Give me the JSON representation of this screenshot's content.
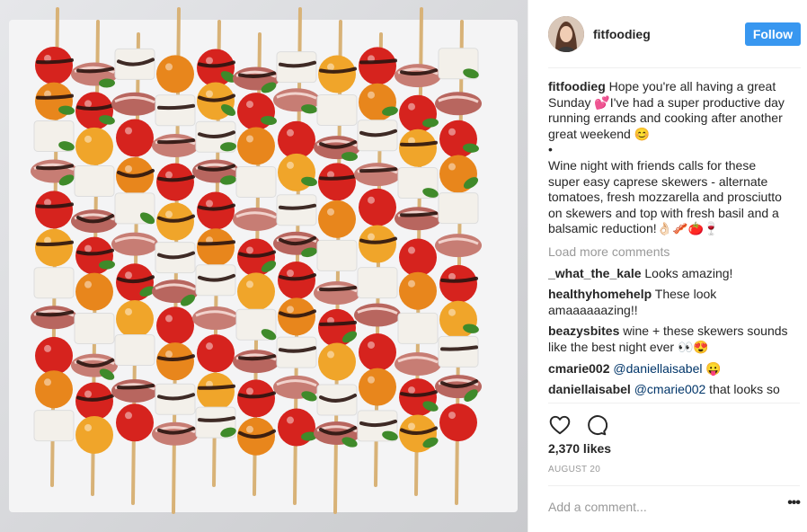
{
  "post": {
    "image": {
      "subject": "caprese skewers with balsamic reduction"
    },
    "author": {
      "username": "fitfoodieg",
      "avatar_icon": "profile-photo"
    },
    "follow_label": "Follow",
    "colors": {
      "accent": "#3897f0",
      "muted": "#999999",
      "mention": "#003569"
    },
    "caption": {
      "username": "fitfoodieg",
      "body": "Hope you're all having a great Sunday 💕I've had a super productive day running errands and cooking after another great weekend 😊\n•\nWine night with friends calls for these super easy caprese skewers - alternate tomatoes, fresh mozzarella and prosciutto on skewers and top with fresh basil and a balsamic reduction!👌🏻🥓🍅🍷"
    },
    "load_more": "Load more comments",
    "comments": [
      {
        "username": "_what_the_kale",
        "text": "Looks amazing!"
      },
      {
        "username": "healthyhomehelp",
        "text": "These look amaaaaaazing!!"
      },
      {
        "username": "beazysbites",
        "text": "wine + these skewers sounds like the best night ever 👀😍"
      },
      {
        "username": "cmarie002",
        "mention": "@daniellaisabel",
        "text": " 😛"
      },
      {
        "username": "daniellaisabel",
        "mention": "@cmarie002",
        "text": " that looks so"
      }
    ],
    "actions": {
      "like_icon": "heart-icon",
      "comment_icon": "comment-bubble-icon"
    },
    "likes": "2,370 likes",
    "date": "AUGUST 20",
    "add_comment_placeholder": "Add a comment...",
    "more_label": "•••"
  }
}
